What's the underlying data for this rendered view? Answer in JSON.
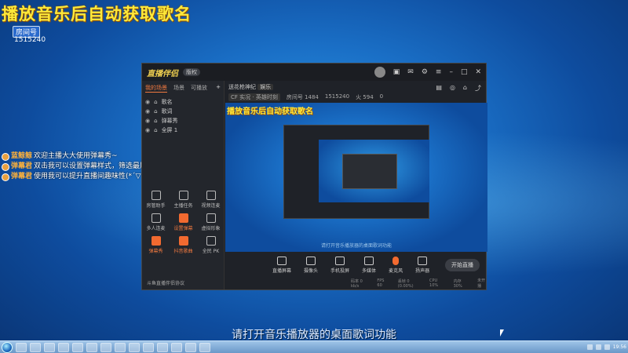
{
  "overlay": {
    "title": "播放音乐后自动获取歌名",
    "room_badge": "房间号",
    "room_number": "1515240",
    "subtitle": "请打开音乐播放器的桌面歌词功能"
  },
  "chat": [
    {
      "user": "蓝鲸鲸",
      "text": "欢迎主播大大使用弹幕秀~"
    },
    {
      "user": "弹幕君",
      "text": "双击我可以设置弹幕样式，筛选最屏搜~"
    },
    {
      "user": "弹幕君",
      "text": "使用我可以提升直播间趣味性(*´▽`*)"
    }
  ],
  "window": {
    "app_name": "直播伴侣",
    "version": "版权",
    "left_tabs": [
      "我的场景",
      "场景",
      "可播放"
    ],
    "scenes": [
      "歌名",
      "歌词",
      "弹幕秀",
      "全屏 1"
    ],
    "tools": [
      {
        "label": "房管助手",
        "hot": false
      },
      {
        "label": "主播任务",
        "hot": false
      },
      {
        "label": "视频连麦",
        "hot": false
      },
      {
        "label": "多人连麦",
        "hot": false
      },
      {
        "label": "设置弹幕",
        "hot": true
      },
      {
        "label": "虚拟形象",
        "hot": false
      },
      {
        "label": "弹幕秀",
        "hot": true
      },
      {
        "label": "抖音歌曲",
        "hot": true
      },
      {
        "label": "全民 PK",
        "hot": false
      }
    ],
    "bottom_hint": "斗鱼直播伴侣协议",
    "header_title": "送花枪神纪",
    "header_tag": "娱乐",
    "header_info": [
      "CF 实况 · 英雄时刻",
      "房间号 1484",
      "1515240",
      "火 594",
      "0"
    ],
    "preview_title": "播放音乐后自动获取歌名",
    "preview_sub": "请打开音乐播放器的桌面歌词功能",
    "toolbar": [
      "直播屏幕",
      "摄像头",
      "手机投屏",
      "多媒体",
      "麦克风",
      "扬声器"
    ],
    "go_live": "开始直播",
    "status": [
      "码率 0 kb/s",
      "FPS 60",
      "丢帧 0 (0.00%)",
      "CPU 10%",
      "内存 30%",
      "未开播"
    ]
  },
  "taskbar": {
    "clock": "19:56"
  },
  "colors": {
    "accent_orange": "#f27a40",
    "title_yellow": "#ffe93a",
    "desktop_blue": "#1a6fc6"
  }
}
